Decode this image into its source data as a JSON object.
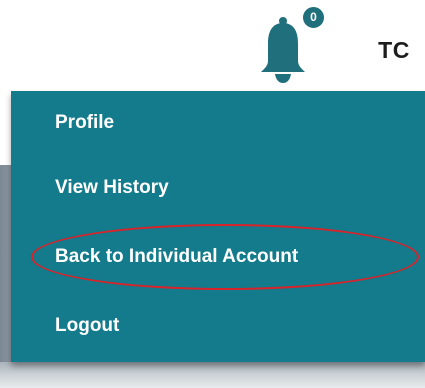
{
  "header": {
    "notification_count": "0",
    "avatar_initials": "TC"
  },
  "menu": {
    "items": [
      {
        "label": "Profile"
      },
      {
        "label": "View History"
      },
      {
        "label": "Back to Individual Account"
      },
      {
        "label": "Logout"
      }
    ],
    "highlighted_item": "Back to Individual Account"
  },
  "colors": {
    "menu_background": "#137b8b",
    "bell": "#1f6f7d",
    "annotation_circle": "#d8232a"
  },
  "icons": {
    "notifications": "bell-icon"
  }
}
